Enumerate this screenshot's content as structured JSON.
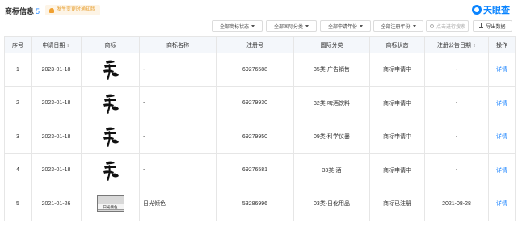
{
  "header": {
    "title": "商标信息",
    "count": "5",
    "notice": "发生变更时通知我",
    "logo_text": "天眼查"
  },
  "filters": [
    {
      "label": "全部商标状态"
    },
    {
      "label": "全部国际分类"
    },
    {
      "label": "全部申请年份"
    },
    {
      "label": "全部注册年份"
    }
  ],
  "search": {
    "placeholder": "点击进行搜索"
  },
  "export_label": "导出数据",
  "table": {
    "columns": [
      "序号",
      "申请日期",
      "商标",
      "商标名称",
      "注册号",
      "国际分类",
      "商标状态",
      "注册公告日期",
      "操作"
    ],
    "rows": [
      {
        "no": "1",
        "date": "2023-01-18",
        "name": "-",
        "reg": "69276588",
        "cls": "35类-广告销售",
        "status": "商标申请中",
        "pub": "-",
        "op": "详情",
        "logo": "calligraphy"
      },
      {
        "no": "2",
        "date": "2023-01-18",
        "name": "-",
        "reg": "69279930",
        "cls": "32类-啤酒饮料",
        "status": "商标申请中",
        "pub": "-",
        "op": "详情",
        "logo": "calligraphy"
      },
      {
        "no": "3",
        "date": "2023-01-18",
        "name": "-",
        "reg": "69279950",
        "cls": "09类-科学仪器",
        "status": "商标申请中",
        "pub": "-",
        "op": "详情",
        "logo": "calligraphy"
      },
      {
        "no": "4",
        "date": "2023-01-18",
        "name": "-",
        "reg": "69276581",
        "cls": "33类-酒",
        "status": "商标申请中",
        "pub": "-",
        "op": "详情",
        "logo": "calligraphy"
      },
      {
        "no": "5",
        "date": "2021-01-26",
        "name": "日光倾色",
        "reg": "53286996",
        "cls": "03类-日化用品",
        "status": "商标已注册",
        "pub": "2021-08-28",
        "op": "详情",
        "logo": "text-box",
        "logo_text": "日光倾色"
      }
    ]
  },
  "colors": {
    "accent": "#1f86ff",
    "notice_bg": "#fdf4e6",
    "notice_text": "#e8a236",
    "header_bg": "#f4f7fb"
  }
}
